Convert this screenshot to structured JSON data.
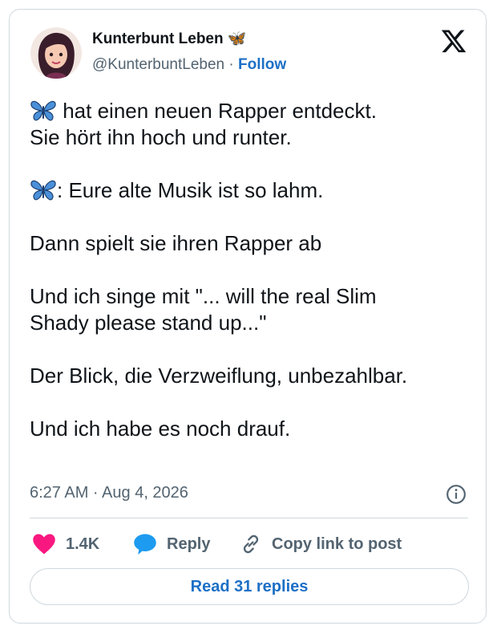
{
  "author": {
    "name": "Kunterbunt Leben 🦋",
    "handle": "@KunterbuntLeben",
    "separator": "·",
    "follow_label": "Follow"
  },
  "tweet": {
    "lines": [
      " hat einen neuen Rapper entdeckt.",
      "Sie hört ihn hoch und runter.",
      ": Eure alte Musik ist so lahm.",
      "Dann spielt sie ihren Rapper ab",
      "Und ich singe mit \"... will the real Slim",
      "Shady please stand up...\"",
      "Der Blick, die Verzweiflung, unbezahlbar.",
      "Und ich habe es noch drauf."
    ]
  },
  "meta": {
    "timestamp": "6:27 AM · Aug 4, 2026"
  },
  "actions": {
    "likes": "1.4K",
    "reply": "Reply",
    "copy_link": "Copy link to post"
  },
  "read_replies": "Read 31 replies",
  "colors": {
    "accent": "#1d70c6",
    "heart": "#f91880",
    "reply_bubble": "#1d9bf0",
    "muted": "#536471",
    "butterfly": "#4a90d9"
  },
  "icons": [
    "avatar",
    "x-logo-icon",
    "butterfly-emoji",
    "info-icon",
    "heart-icon",
    "reply-bubble-icon",
    "link-icon"
  ]
}
